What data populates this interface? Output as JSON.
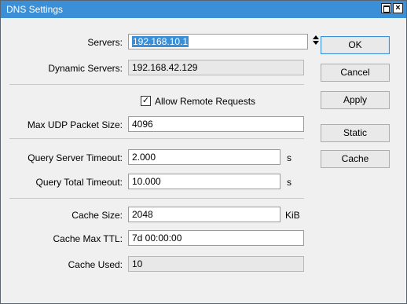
{
  "window": {
    "title": "DNS Settings",
    "maximize_glyph": "",
    "close_glyph": "×"
  },
  "form": {
    "servers": {
      "label": "Servers:",
      "value": "192.168.10.1"
    },
    "dynamic_servers": {
      "label": "Dynamic Servers:",
      "value": "192.168.42.129"
    },
    "allow_remote": {
      "label": "Allow Remote Requests",
      "checked": true,
      "check_glyph": "✓"
    },
    "max_udp": {
      "label": "Max UDP Packet Size:",
      "value": "4096"
    },
    "query_server_timeout": {
      "label": "Query Server Timeout:",
      "value": "2.000",
      "unit": "s"
    },
    "query_total_timeout": {
      "label": "Query Total Timeout:",
      "value": "10.000",
      "unit": "s"
    },
    "cache_size": {
      "label": "Cache Size:",
      "value": "2048",
      "unit": "KiB"
    },
    "cache_max_ttl": {
      "label": "Cache Max TTL:",
      "value": "7d 00:00:00"
    },
    "cache_used": {
      "label": "Cache Used:",
      "value": "10"
    }
  },
  "buttons": {
    "ok": "OK",
    "cancel": "Cancel",
    "apply": "Apply",
    "static": "Static",
    "cache": "Cache"
  },
  "icons": {
    "stepper": "updown-arrows-icon"
  },
  "colors": {
    "titlebar": "#3b8fd6",
    "selection": "#3b8fd6"
  }
}
